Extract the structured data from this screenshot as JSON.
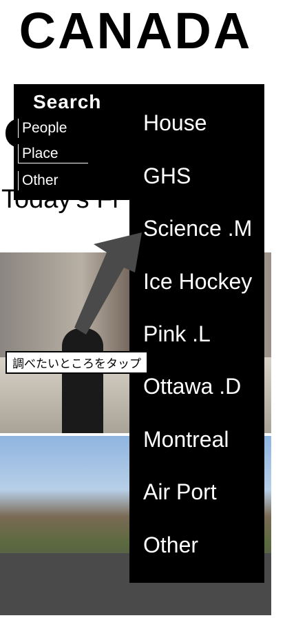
{
  "header": {
    "title": "CANADA",
    "subtitle": "Today's Fi"
  },
  "search_menu": {
    "heading": "Search",
    "items": [
      "People",
      "Place",
      "Other"
    ]
  },
  "category_menu": {
    "items": [
      "House",
      "GHS",
      "Science .M",
      "Ice Hockey",
      "Pink .L",
      "Ottawa .D",
      "Montreal",
      "Air Port",
      "Other"
    ]
  },
  "tooltip": {
    "text": "調べたいところをタップ"
  }
}
